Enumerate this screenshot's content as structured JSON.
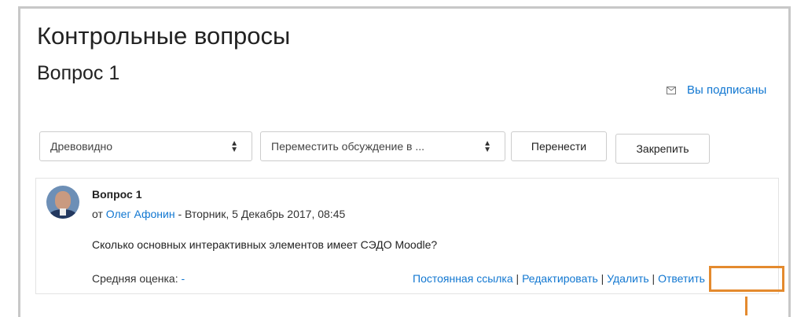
{
  "page": {
    "forum_title": "Контрольные вопросы",
    "discussion_title": "Вопрос 1",
    "subscribed_label": "Вы подписаны"
  },
  "toolbar": {
    "display_mode_value": "Древовидно",
    "move_discussion_value": "Переместить обсуждение в ...",
    "move_button": "Перенести",
    "pin_button": "Закрепить"
  },
  "post": {
    "subject": "Вопрос 1",
    "by_prefix": "от",
    "author": "Олег Афонин",
    "date": "- Вторник, 5 Декабрь 2017, 08:45",
    "message": "Сколько основных интерактивных элементов имеет СЭДО Moodle?",
    "rating_label": "Средняя оценка:",
    "rating_value": "-",
    "commands": {
      "permalink": "Постоянная ссылка",
      "edit": "Редактировать",
      "delete": "Удалить",
      "reply": "Ответить"
    },
    "separator": "|"
  },
  "icons": {
    "envelope": "envelope-icon",
    "select_caret": "sort-caret-icon"
  },
  "colors": {
    "link": "#1177d1",
    "highlight": "#e48a2e",
    "frame": "#c8c8c8"
  }
}
